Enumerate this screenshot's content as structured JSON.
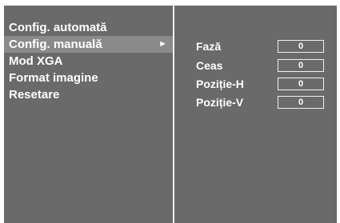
{
  "menu": {
    "items": [
      {
        "label": "Config. automată",
        "selected": false
      },
      {
        "label": "Config. manuală",
        "selected": true,
        "arrow": "►"
      },
      {
        "label": "Mod XGA",
        "selected": false
      },
      {
        "label": "Format imagine",
        "selected": false
      },
      {
        "label": "Resetare",
        "selected": false
      }
    ]
  },
  "params": [
    {
      "label": "Fază",
      "value": "0"
    },
    {
      "label": "Ceas",
      "value": "0"
    },
    {
      "label": "Poziție-H",
      "value": "0"
    },
    {
      "label": "Poziție-V",
      "value": "0"
    }
  ],
  "colors": {
    "panel_bg": "#6a6a6a",
    "selected_bg": "#8a8a8a",
    "text": "#ffffff",
    "divider": "#f2f2f2"
  },
  "icons": {
    "submenu_arrow": "arrow-right-icon"
  }
}
